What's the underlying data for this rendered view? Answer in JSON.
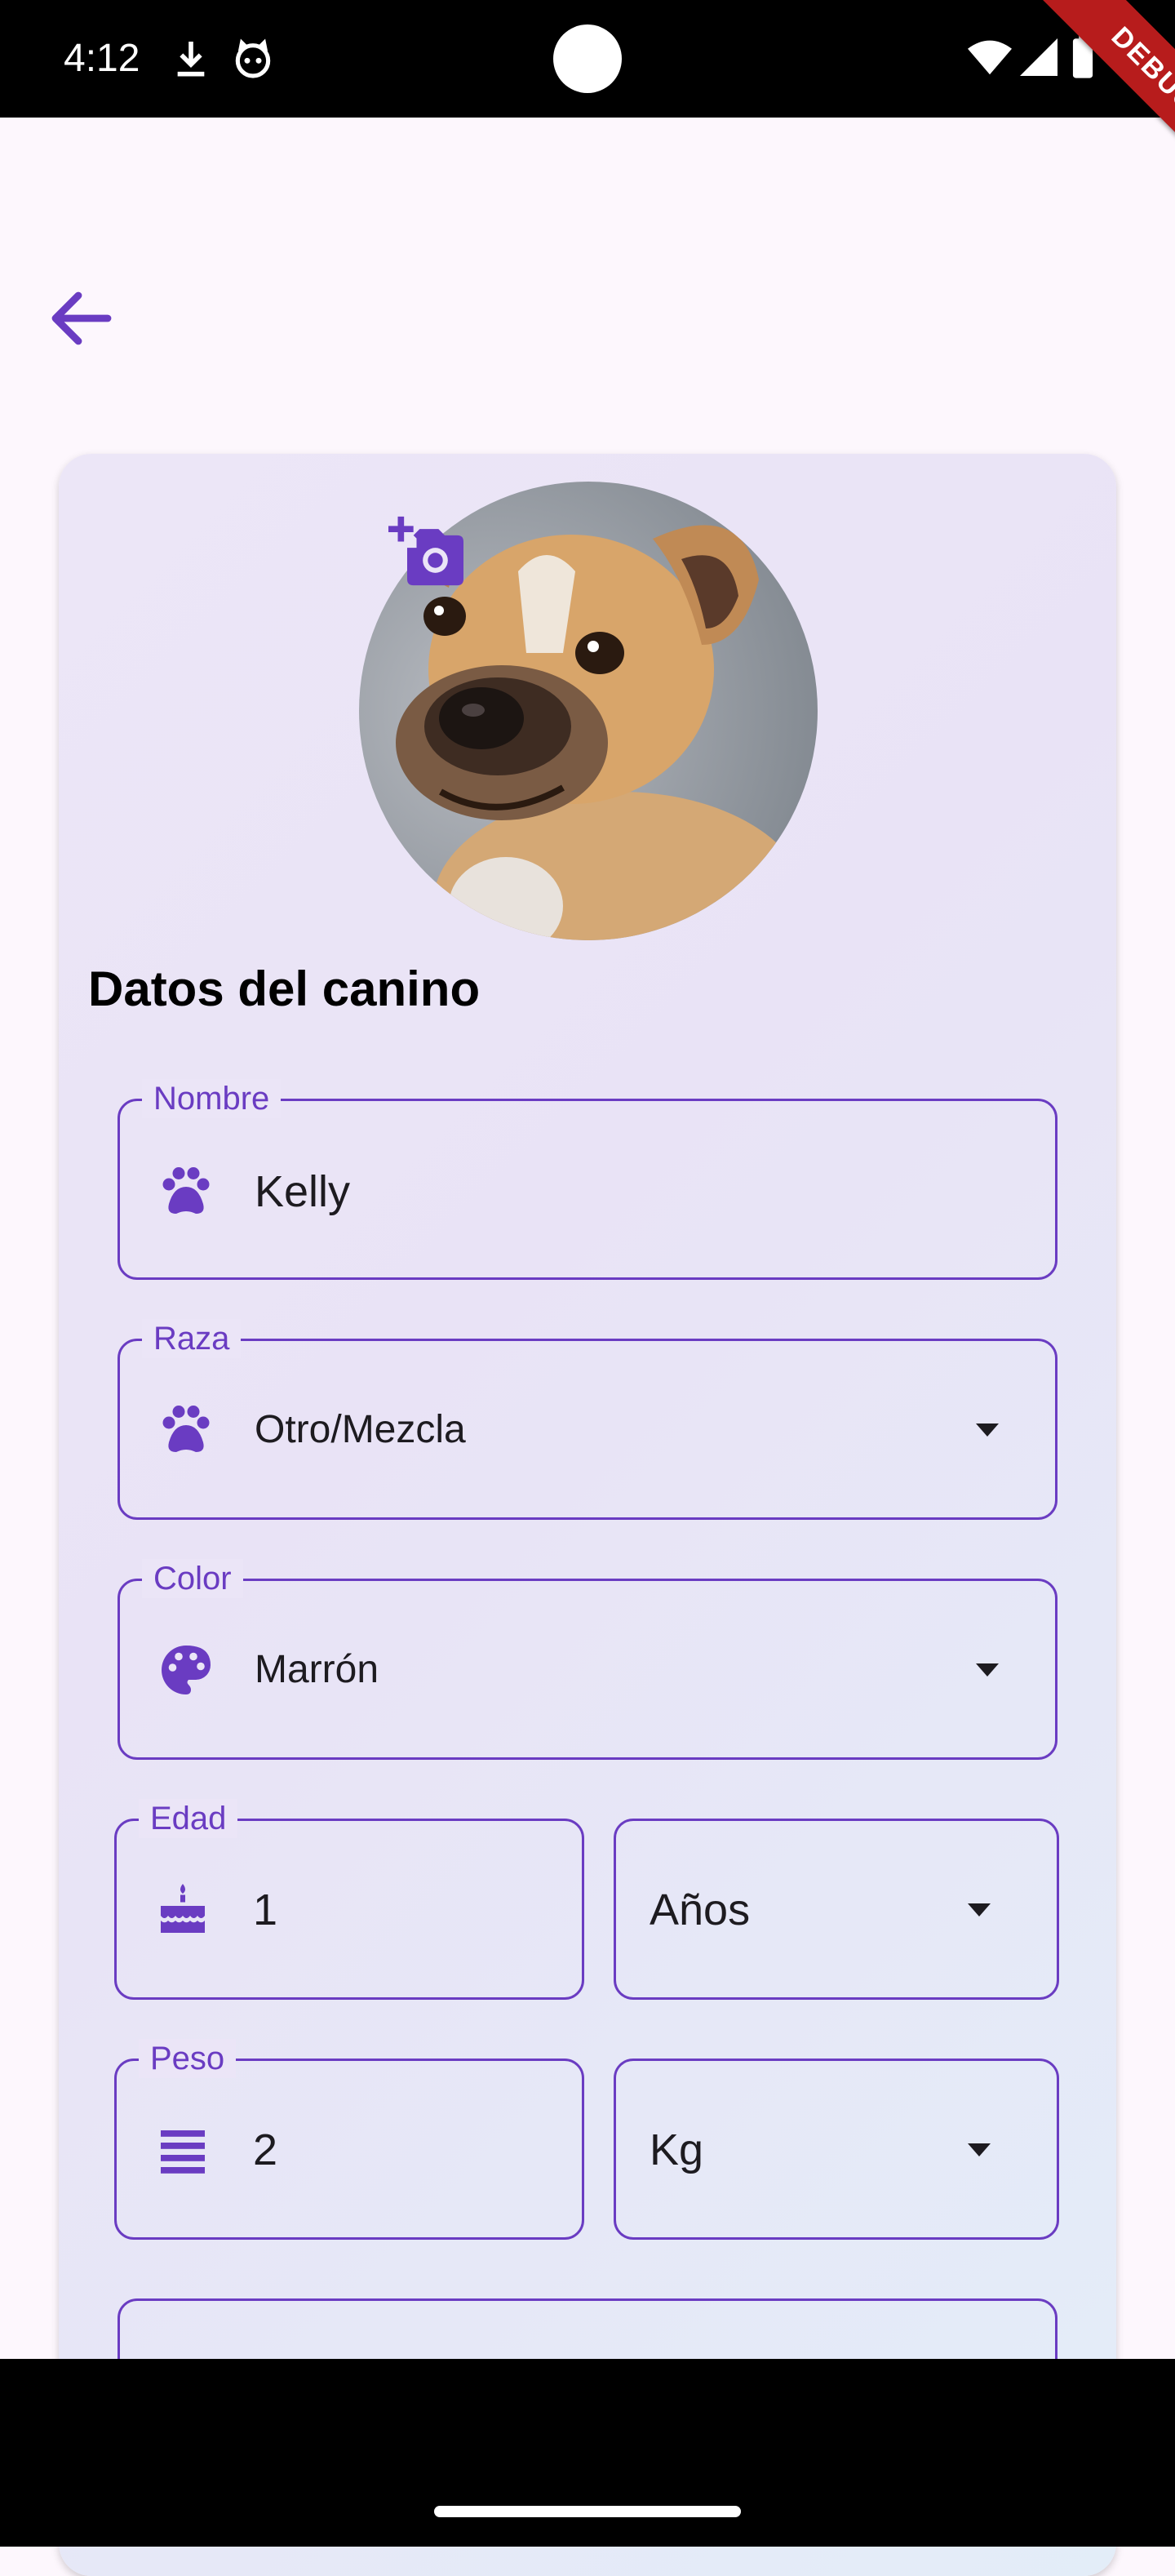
{
  "status_bar": {
    "time": "4:12",
    "icons": [
      "download-icon",
      "cat-face-icon",
      "wifi-icon",
      "signal-icon",
      "battery-icon"
    ]
  },
  "debug_banner": "DEBUG",
  "form": {
    "section_title": "Datos del canino",
    "avatar_icon": "add-a-photo-icon",
    "nombre": {
      "label": "Nombre",
      "value": "Kelly",
      "icon": "paw-icon"
    },
    "raza": {
      "label": "Raza",
      "value": "Otro/Mezcla",
      "icon": "paw-icon"
    },
    "color": {
      "label": "Color",
      "value": "Marrón",
      "icon": "palette-icon"
    },
    "edad": {
      "label": "Edad",
      "value": "1",
      "icon": "cake-icon",
      "unit": "Años"
    },
    "peso": {
      "label": "Peso",
      "value": "2",
      "icon": "scale-lines-icon",
      "unit": "Kg"
    }
  },
  "colors": {
    "accent": "#6a3cc2",
    "background": "#fdf7fd",
    "card_start": "#ece6f7",
    "card_end": "#e3edf8"
  }
}
